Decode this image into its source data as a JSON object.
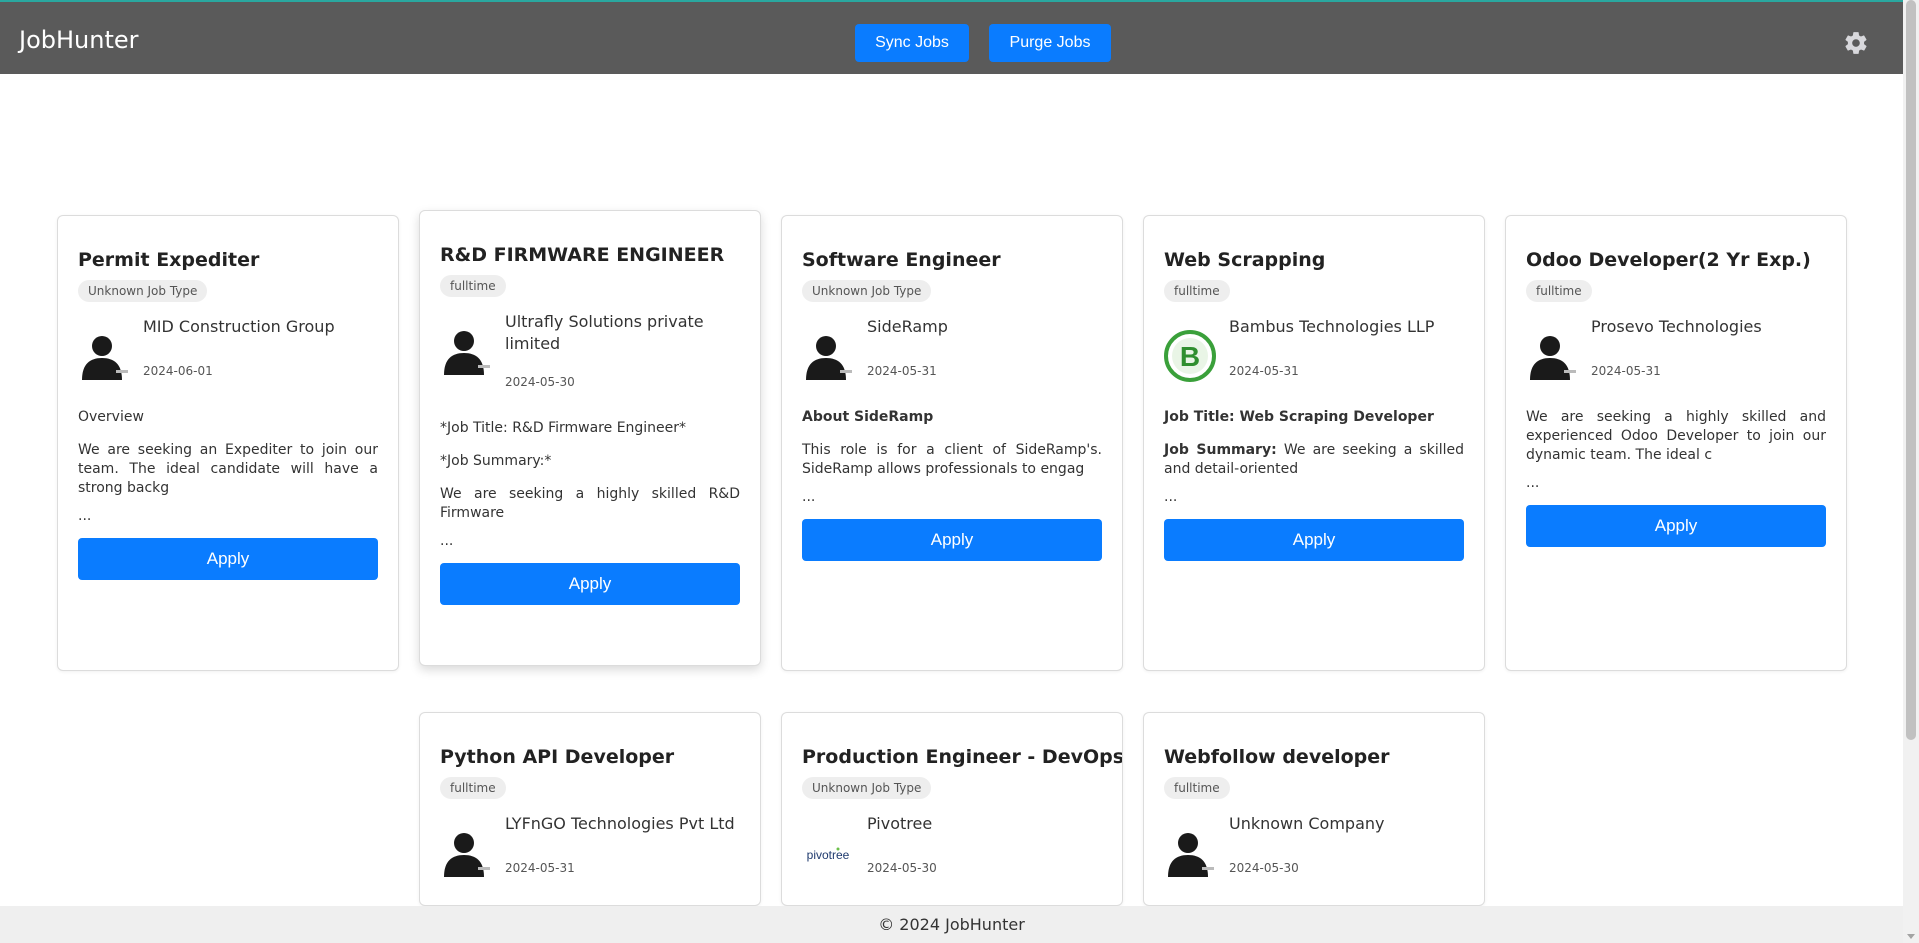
{
  "app": {
    "title": "JobHunter",
    "sync_label": "Sync Jobs",
    "purge_label": "Purge Jobs",
    "settings_icon": "gear-icon"
  },
  "jobs": [
    {
      "title": "Permit Expediter",
      "type": "Unknown Job Type",
      "company": "MID Construction Group",
      "date": "2024-06-01",
      "logo": "default-avatar",
      "desc_heading": "Overview",
      "desc_text": "We are seeking an Expediter to join our team. The ideal candidate will have a strong backg",
      "ellipsis": "...",
      "apply_label": "Apply"
    },
    {
      "title": "R&D FIRMWARE ENGINEER",
      "type": "fulltime",
      "company": "Ultrafly Solutions private limited",
      "date": "2024-05-30",
      "logo": "default-avatar",
      "desc_heading": "*Job Title: R&D Firmware Engineer*",
      "desc_sub": "*Job Summary:*",
      "desc_text": "We are seeking a highly skilled R&D Firmware",
      "ellipsis": "...",
      "apply_label": "Apply"
    },
    {
      "title": "Software Engineer",
      "type": "Unknown Job Type",
      "company": "SideRamp",
      "date": "2024-05-31",
      "logo": "default-avatar",
      "desc_heading": "About SideRamp",
      "desc_text": "This role is for a client of SideRamp's. SideRamp allows professionals to engag",
      "ellipsis": "...",
      "apply_label": "Apply"
    },
    {
      "title": "Web Scrapping",
      "type": "fulltime",
      "company": "Bambus Technologies LLP",
      "date": "2024-05-31",
      "logo": "bambus-logo",
      "desc_heading": "Job Title: Web Scraping Developer",
      "desc_label": "Job Summary:",
      "desc_text": " We are seeking a skilled and detail-oriented",
      "ellipsis": "...",
      "apply_label": "Apply"
    },
    {
      "title": "Odoo Developer(2 Yr Exp.)",
      "type": "fulltime",
      "company": "Prosevo Technologies",
      "date": "2024-05-31",
      "logo": "default-avatar",
      "desc_text": "We are seeking a highly skilled and experienced Odoo Developer to join our dynamic team. The ideal c",
      "ellipsis": "...",
      "apply_label": "Apply"
    },
    {
      "title": "Python API Developer",
      "type": "fulltime",
      "company": "LYFnGO Technologies Pvt Ltd",
      "date": "2024-05-31",
      "logo": "default-avatar"
    },
    {
      "title": "Production Engineer - DevOps",
      "type": "Unknown Job Type",
      "company": "Pivotree",
      "date": "2024-05-30",
      "logo": "pivotree-logo",
      "logo_text": "pivotree"
    },
    {
      "title": "Webfollow developer",
      "type": "fulltime",
      "company": "Unknown Company",
      "date": "2024-05-30",
      "logo": "default-avatar"
    }
  ],
  "footer": {
    "text": "© 2024 JobHunter"
  }
}
